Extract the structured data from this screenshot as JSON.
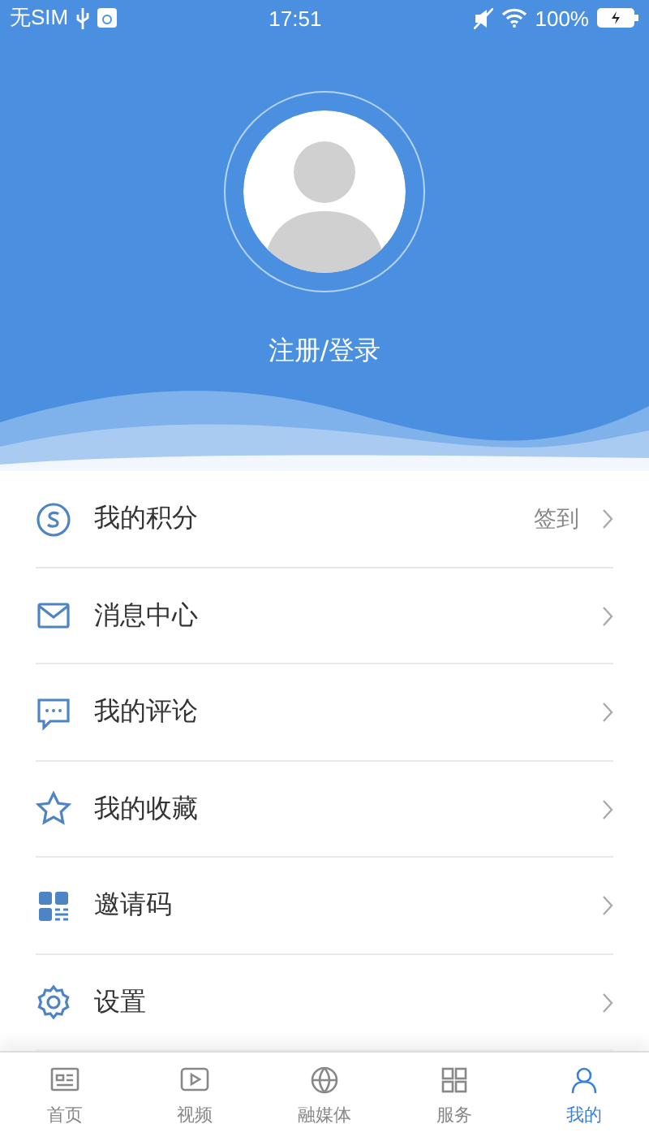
{
  "status_bar": {
    "carrier": "无SIM",
    "time": "17:51",
    "battery": "100%"
  },
  "profile": {
    "login": "注册/登录"
  },
  "menu": [
    {
      "kind": "points",
      "label": "我的积分",
      "action": "签到"
    },
    {
      "kind": "message",
      "label": "消息中心"
    },
    {
      "kind": "comment",
      "label": "我的评论"
    },
    {
      "kind": "favorite",
      "label": "我的收藏"
    },
    {
      "kind": "invite",
      "label": "邀请码"
    },
    {
      "kind": "settings",
      "label": "设置"
    }
  ],
  "tabs": [
    {
      "kind": "home",
      "label": "首页",
      "selected": false
    },
    {
      "kind": "video",
      "label": "视频",
      "selected": false
    },
    {
      "kind": "media",
      "label": "融媒体",
      "selected": false
    },
    {
      "kind": "service",
      "label": "服务",
      "selected": false
    },
    {
      "kind": "me",
      "label": "我的",
      "selected": true
    }
  ]
}
